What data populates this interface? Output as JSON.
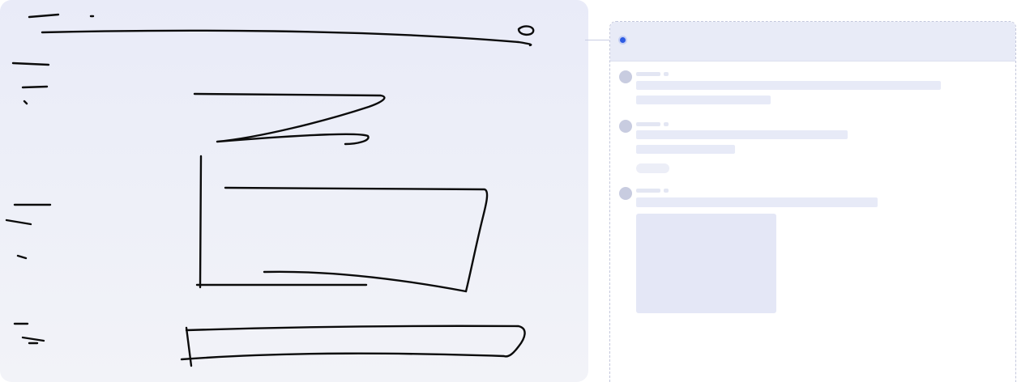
{
  "screen": {
    "left_panel": {
      "type": "hand-drawn-wireframe-sketch",
      "stroke_color": "#0b0b0b"
    },
    "right_panel": {
      "type": "skeleton-feed-preview",
      "anchor_dot_color": "#2d5be3",
      "header_bg": "#e8ebf7",
      "skeleton_color": "#e7eaf7",
      "avatar_color": "#c8cce0",
      "items": [
        {
          "kind": "text-post",
          "lines": 2
        },
        {
          "kind": "text-post-with-pill",
          "lines": 2
        },
        {
          "kind": "image-post",
          "lines": 1
        }
      ]
    }
  }
}
